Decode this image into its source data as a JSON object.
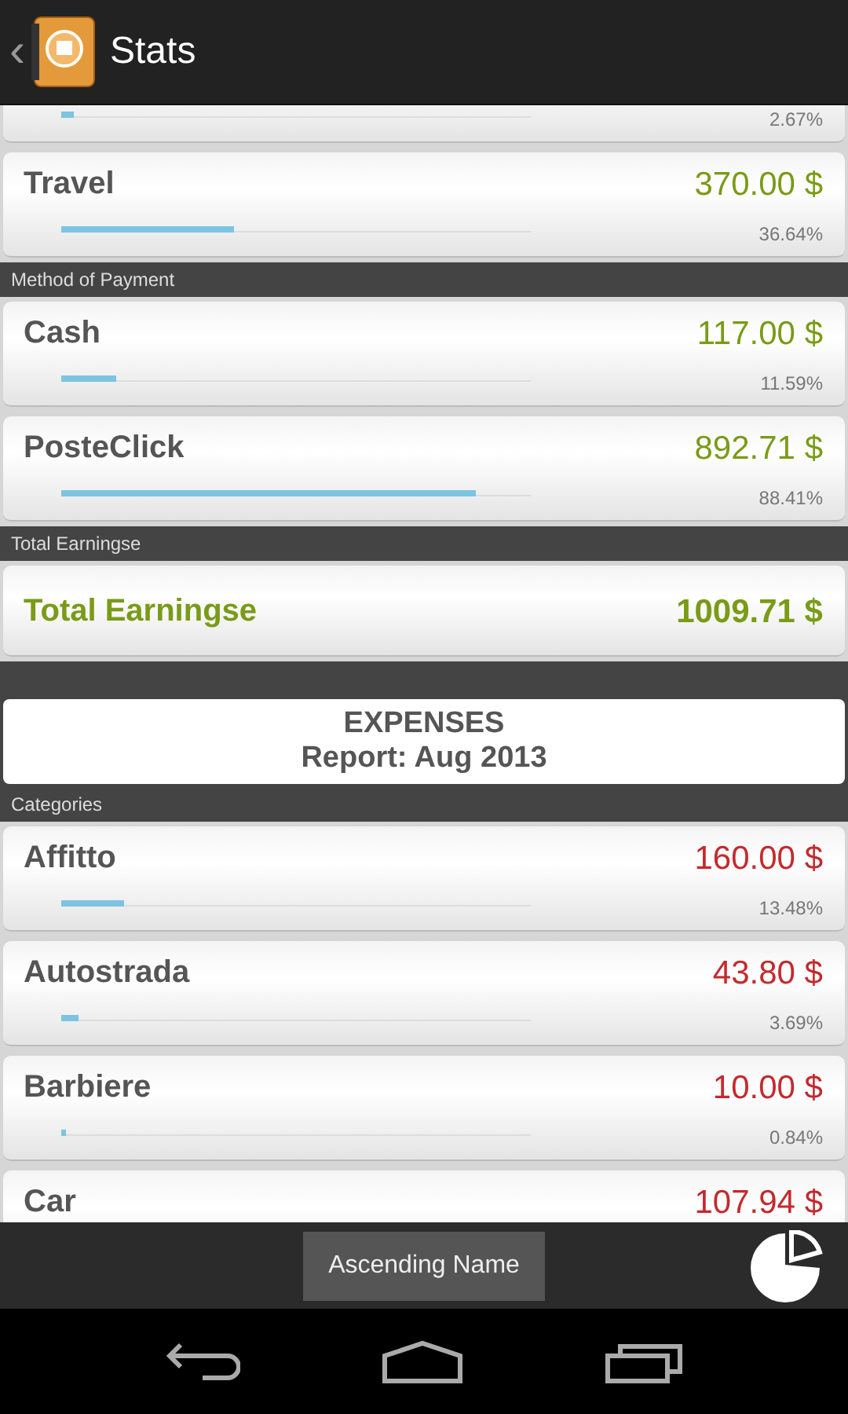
{
  "app_bar": {
    "back": "‹",
    "title": "Stats"
  },
  "items": [
    {
      "kind": "partial_row",
      "level": 0.0267,
      "percent": "2.67%"
    },
    {
      "kind": "row",
      "color": "#7a9b17",
      "name": "Travel",
      "amount": "370.00 $",
      "level": 0.3664,
      "percent": "36.64%"
    },
    {
      "kind": "header",
      "label": "Method of Payment"
    },
    {
      "kind": "row",
      "color": "#7a9b17",
      "name": "Cash",
      "amount": "117.00 $",
      "level": 0.1159,
      "percent": "11.59%"
    },
    {
      "kind": "row",
      "color": "#7a9b17",
      "name": "PosteClick",
      "amount": "892.71 $",
      "level": 0.8841,
      "percent": "88.41%"
    },
    {
      "kind": "header",
      "label": "Total Earningse"
    },
    {
      "kind": "total",
      "name": "Total Earningse",
      "amount": "1009.71 $"
    },
    {
      "kind": "spacer"
    },
    {
      "kind": "report",
      "title": "EXPENSES",
      "subtitle": "Report: Aug 2013"
    },
    {
      "kind": "header",
      "label": "Categories"
    },
    {
      "kind": "row",
      "color": "#c42a2e",
      "name": "Affitto",
      "amount": "160.00 $",
      "level": 0.1348,
      "percent": "13.48%"
    },
    {
      "kind": "row",
      "color": "#c42a2e",
      "name": "Autostrada",
      "amount": "43.80 $",
      "level": 0.0369,
      "percent": "3.69%"
    },
    {
      "kind": "row",
      "color": "#c42a2e",
      "name": "Barbiere",
      "amount": "10.00 $",
      "level": 0.0084,
      "percent": "0.84%"
    },
    {
      "kind": "row",
      "color": "#c42a2e",
      "name": "Car",
      "amount": "107.94 $"
    }
  ],
  "bottom_bar": {
    "sort_button": "Ascending Name"
  }
}
